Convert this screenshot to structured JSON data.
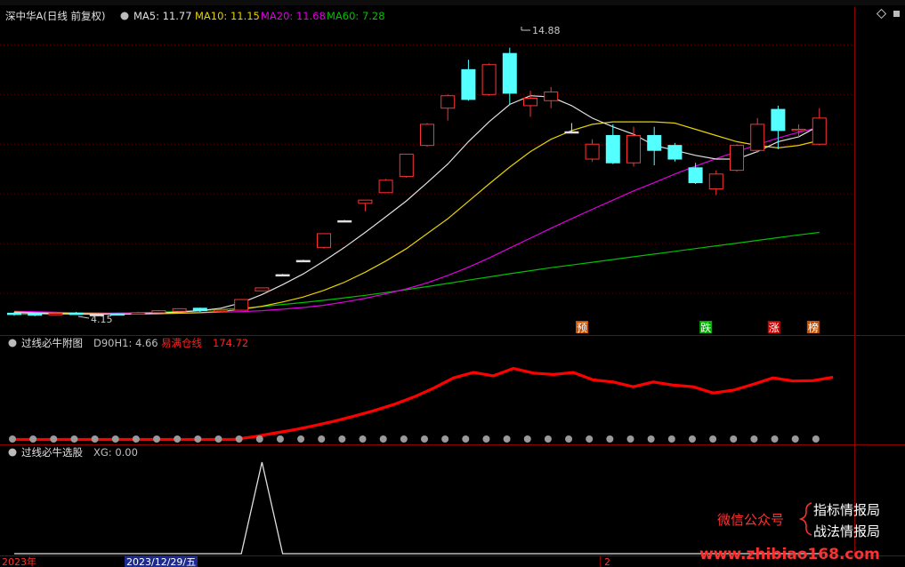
{
  "header": {
    "stock_name": "深中华A(日线 前复权)",
    "ma5_label": "MA5: 11.77",
    "ma10_label": "MA10: 11.15",
    "ma20_label": "MA20: 11.68",
    "ma60_label": "MA60: 7.28",
    "high_label": "14.88",
    "low_label": "4.15"
  },
  "signals": [
    "预",
    "跌",
    "涨",
    "榜"
  ],
  "panel2": {
    "name": "过线必牛附图",
    "d90h1_label": "D90H1: 4.66",
    "sell_label": "易满仓线",
    "sell_value": "174.72"
  },
  "panel3": {
    "name": "过线必牛选股",
    "xg_label": "XG: 0.00"
  },
  "footer": {
    "year": "2023年",
    "date": "2023/12/29/五",
    "tick": "2"
  },
  "watermark": {
    "line1": "微信公众号",
    "line2a": "指标情报局",
    "line2b": "战法情报局",
    "url": "www.zhibiao168.com"
  },
  "colors": {
    "up": "#ff3232",
    "down": "#54ffff",
    "ma5": "#e0e0e0",
    "ma10": "#e6d200",
    "ma20": "#e000e0",
    "ma60": "#00c000",
    "red_line": "#ff0000"
  },
  "chart_data": [
    {
      "type": "candlestick",
      "ylim": [
        3.5,
        15.8
      ],
      "candles": [
        {
          "o": 4.2,
          "c": 4.15,
          "h": 4.25,
          "l": 4.1
        },
        {
          "o": 4.18,
          "c": 4.12,
          "h": 4.22,
          "l": 4.08
        },
        {
          "o": 4.16,
          "c": 4.19,
          "h": 4.24,
          "l": 4.12
        },
        {
          "o": 4.2,
          "c": 4.17,
          "h": 4.25,
          "l": 4.13
        },
        {
          "o": 4.15,
          "c": 4.15,
          "h": 4.18,
          "l": 4.1
        },
        {
          "o": 4.18,
          "c": 4.15,
          "h": 4.2,
          "l": 4.12
        },
        {
          "o": 4.16,
          "c": 4.22,
          "h": 4.26,
          "l": 4.14
        },
        {
          "o": 4.22,
          "c": 4.3,
          "h": 4.33,
          "l": 4.2
        },
        {
          "o": 4.28,
          "c": 4.38,
          "h": 4.4,
          "l": 4.26
        },
        {
          "o": 4.4,
          "c": 4.3,
          "h": 4.42,
          "l": 4.25
        },
        {
          "o": 4.3,
          "c": 4.32,
          "h": 4.36,
          "l": 4.28
        },
        {
          "o": 4.32,
          "c": 4.75,
          "h": 4.75,
          "l": 4.3
        },
        {
          "o": 5.1,
          "c": 5.22,
          "h": 5.22,
          "l": 5.1
        },
        {
          "o": 5.75,
          "c": 5.75,
          "h": 5.78,
          "l": 5.72
        },
        {
          "o": 6.32,
          "c": 6.32,
          "h": 6.35,
          "l": 6.3
        },
        {
          "o": 6.85,
          "c": 7.4,
          "h": 7.4,
          "l": 6.8
        },
        {
          "o": 7.92,
          "c": 7.92,
          "h": 7.95,
          "l": 7.9
        },
        {
          "o": 8.62,
          "c": 8.75,
          "h": 8.75,
          "l": 8.3
        },
        {
          "o": 9.05,
          "c": 9.55,
          "h": 9.6,
          "l": 9.05
        },
        {
          "o": 9.7,
          "c": 10.6,
          "h": 10.6,
          "l": 9.65
        },
        {
          "o": 10.95,
          "c": 11.8,
          "h": 11.85,
          "l": 10.9
        },
        {
          "o": 12.45,
          "c": 12.95,
          "h": 13.0,
          "l": 11.95
        },
        {
          "o": 14.0,
          "c": 12.8,
          "h": 14.4,
          "l": 12.75
        },
        {
          "o": 13.0,
          "c": 14.2,
          "h": 14.25,
          "l": 12.95
        },
        {
          "o": 14.65,
          "c": 13.05,
          "h": 14.88,
          "l": 12.6
        },
        {
          "o": 12.55,
          "c": 12.85,
          "h": 13.15,
          "l": 12.1
        },
        {
          "o": 12.75,
          "c": 13.1,
          "h": 13.3,
          "l": 12.45
        },
        {
          "o": 11.5,
          "c": 11.5,
          "h": 11.85,
          "l": 11.45
        },
        {
          "o": 10.4,
          "c": 11.0,
          "h": 11.2,
          "l": 10.3
        },
        {
          "o": 11.35,
          "c": 10.25,
          "h": 11.8,
          "l": 10.2
        },
        {
          "o": 10.25,
          "c": 11.35,
          "h": 11.7,
          "l": 10.1
        },
        {
          "o": 11.35,
          "c": 10.75,
          "h": 11.7,
          "l": 10.15
        },
        {
          "o": 10.95,
          "c": 10.4,
          "h": 11.05,
          "l": 10.3
        },
        {
          "o": 10.05,
          "c": 9.45,
          "h": 10.25,
          "l": 9.4
        },
        {
          "o": 9.2,
          "c": 9.8,
          "h": 9.95,
          "l": 8.95
        },
        {
          "o": 9.95,
          "c": 10.95,
          "h": 11.0,
          "l": 9.9
        },
        {
          "o": 10.75,
          "c": 11.8,
          "h": 12.05,
          "l": 10.65
        },
        {
          "o": 12.4,
          "c": 11.55,
          "h": 12.55,
          "l": 10.8
        },
        {
          "o": 11.55,
          "c": 11.6,
          "h": 11.8,
          "l": 11.3
        },
        {
          "o": 11.0,
          "c": 12.05,
          "h": 12.45,
          "l": 10.95
        }
      ],
      "ma5": [
        4.22,
        4.2,
        4.18,
        4.17,
        4.16,
        4.16,
        4.17,
        4.2,
        4.25,
        4.3,
        4.4,
        4.62,
        4.95,
        5.35,
        5.78,
        6.3,
        6.85,
        7.45,
        8.08,
        8.72,
        9.45,
        10.2,
        11.1,
        11.9,
        12.6,
        12.95,
        12.9,
        12.55,
        12.05,
        11.7,
        11.4,
        10.95,
        10.75,
        10.55,
        10.4,
        10.4,
        10.7,
        11.1,
        11.3,
        11.75
      ],
      "ma10": [
        4.25,
        4.22,
        4.2,
        4.19,
        4.18,
        4.17,
        4.17,
        4.18,
        4.2,
        4.22,
        4.27,
        4.35,
        4.48,
        4.65,
        4.85,
        5.12,
        5.45,
        5.85,
        6.3,
        6.8,
        7.4,
        8.0,
        8.7,
        9.4,
        10.08,
        10.7,
        11.2,
        11.55,
        11.8,
        11.9,
        11.9,
        11.9,
        11.85,
        11.6,
        11.35,
        11.1,
        10.95,
        10.85,
        10.95,
        11.15
      ],
      "ma20": [
        4.28,
        4.26,
        4.24,
        4.22,
        4.21,
        4.2,
        4.2,
        4.2,
        4.21,
        4.22,
        4.24,
        4.26,
        4.3,
        4.36,
        4.43,
        4.52,
        4.65,
        4.8,
        4.98,
        5.18,
        5.42,
        5.72,
        6.05,
        6.42,
        6.82,
        7.22,
        7.62,
        8.0,
        8.38,
        8.75,
        9.12,
        9.45,
        9.8,
        10.12,
        10.42,
        10.7,
        10.98,
        11.25,
        11.48,
        11.68
      ],
      "ma60": [
        4.15,
        4.16,
        4.17,
        4.18,
        4.19,
        4.2,
        4.22,
        4.24,
        4.27,
        4.3,
        4.35,
        4.4,
        4.47,
        4.55,
        4.63,
        4.72,
        4.82,
        4.92,
        5.03,
        5.15,
        5.27,
        5.4,
        5.53,
        5.66,
        5.79,
        5.91,
        6.03,
        6.14,
        6.25,
        6.36,
        6.47,
        6.58,
        6.69,
        6.8,
        6.91,
        7.02,
        7.13,
        7.24,
        7.35,
        7.45
      ]
    },
    {
      "type": "line",
      "ylim": [
        0,
        260
      ],
      "values": [
        4,
        4,
        4,
        4,
        4,
        4,
        4,
        4,
        4,
        4,
        4,
        4,
        12,
        22,
        32,
        44,
        57,
        72,
        88,
        106,
        128,
        154,
        184,
        200,
        190,
        212,
        198,
        194,
        200,
        178,
        172,
        158,
        172,
        163,
        158,
        140,
        148,
        165,
        184,
        175,
        176,
        186
      ],
      "dots_value": 4
    },
    {
      "type": "line",
      "ylim": [
        0,
        1
      ],
      "values": [
        0,
        0,
        0,
        0,
        0,
        0,
        0,
        0,
        0,
        0,
        0,
        0,
        1,
        0,
        0,
        0,
        0,
        0,
        0,
        0,
        0,
        0,
        0,
        0,
        0,
        0,
        0,
        0,
        0,
        0,
        0,
        0,
        0,
        0,
        0,
        0,
        0,
        0,
        0,
        0
      ]
    }
  ]
}
